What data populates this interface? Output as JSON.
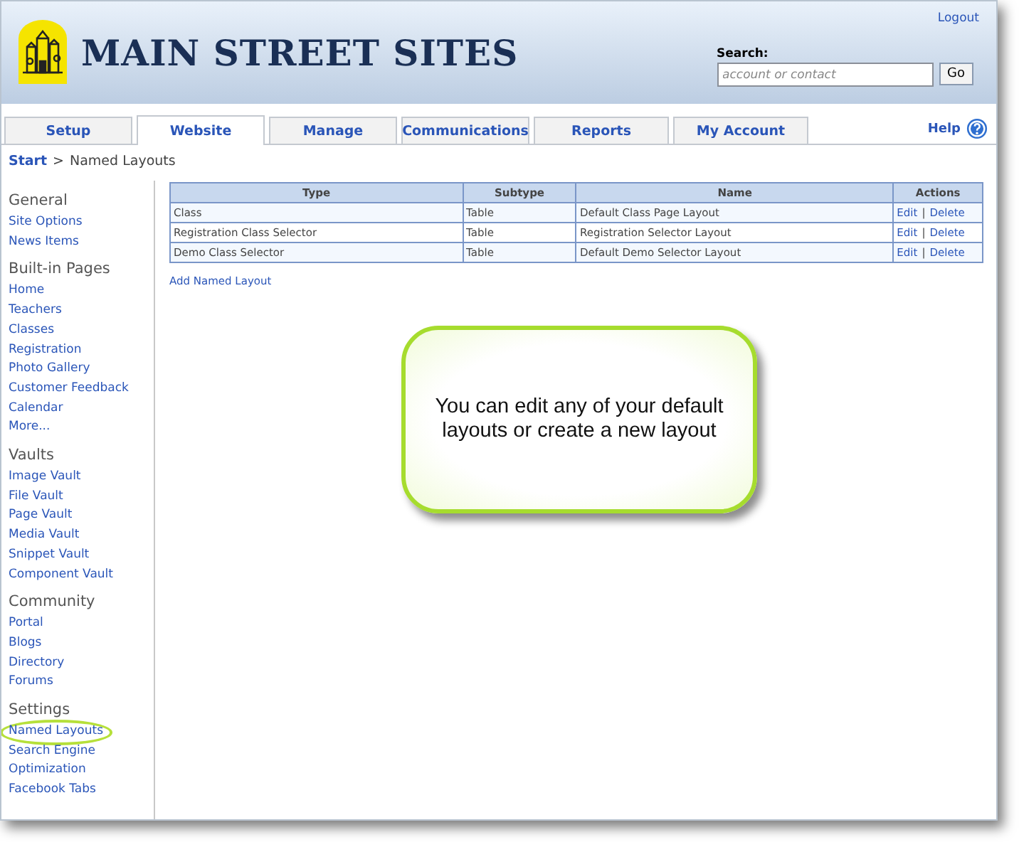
{
  "header": {
    "logo_text": "MAIN STREET SITES",
    "logout": "Logout",
    "search": {
      "label": "Search:",
      "placeholder": "account or contact",
      "button": "Go"
    }
  },
  "tabs": [
    {
      "label": "Setup",
      "selected": false
    },
    {
      "label": "Website",
      "selected": true
    },
    {
      "label": "Manage",
      "selected": false
    },
    {
      "label": "Communications",
      "selected": false
    },
    {
      "label": "Reports",
      "selected": false
    },
    {
      "label": "My Account",
      "selected": false
    }
  ],
  "help": "Help",
  "breadcrumb": {
    "link": "Start",
    "separator": ">",
    "current": "Named Layouts"
  },
  "sidebar": [
    {
      "heading": "General",
      "items": [
        {
          "label": "Site Options",
          "circled": false
        },
        {
          "label": "News Items",
          "circled": false
        }
      ]
    },
    {
      "heading": "Built-in Pages",
      "items": [
        {
          "label": "Home",
          "circled": false
        },
        {
          "label": "Teachers",
          "circled": false
        },
        {
          "label": "Classes",
          "circled": false
        },
        {
          "label": "Registration",
          "circled": false
        },
        {
          "label": "Photo Gallery",
          "circled": false
        },
        {
          "label": "Customer Feedback",
          "circled": false
        },
        {
          "label": "Calendar",
          "circled": false
        },
        {
          "label": "More...",
          "circled": false
        }
      ]
    },
    {
      "heading": "Vaults",
      "items": [
        {
          "label": "Image Vault",
          "circled": false
        },
        {
          "label": "File Vault",
          "circled": false
        },
        {
          "label": "Page Vault",
          "circled": false
        },
        {
          "label": "Media Vault",
          "circled": false
        },
        {
          "label": "Snippet Vault",
          "circled": false
        },
        {
          "label": "Component Vault",
          "circled": false
        }
      ]
    },
    {
      "heading": "Community",
      "items": [
        {
          "label": "Portal",
          "circled": false
        },
        {
          "label": "Blogs",
          "circled": false
        },
        {
          "label": "Directory",
          "circled": false
        },
        {
          "label": "Forums",
          "circled": false
        }
      ]
    },
    {
      "heading": "Settings",
      "items": [
        {
          "label": "Named Layouts",
          "circled": true
        },
        {
          "label": "Search Engine Optimization",
          "circled": false
        },
        {
          "label": "Facebook Tabs",
          "circled": false
        }
      ]
    }
  ],
  "table": {
    "columns": [
      "Type",
      "Subtype",
      "Name",
      "Actions"
    ],
    "rows": [
      {
        "type": "Class",
        "subtype": "Table",
        "name": "Default Class Page Layout",
        "actions": [
          "Edit",
          "|",
          "Delete"
        ]
      },
      {
        "type": "Registration Class Selector",
        "subtype": "Table",
        "name": "Registration Selector Layout",
        "actions": [
          "Edit",
          "|",
          "Delete"
        ]
      },
      {
        "type": "Demo Class Selector",
        "subtype": "Table",
        "name": "Default Demo Selector Layout",
        "actions": [
          "Edit",
          "|",
          "Delete"
        ]
      }
    ],
    "add_link": "Add Named Layout"
  },
  "callout": "You can edit any of your default layouts or create a new layout"
}
